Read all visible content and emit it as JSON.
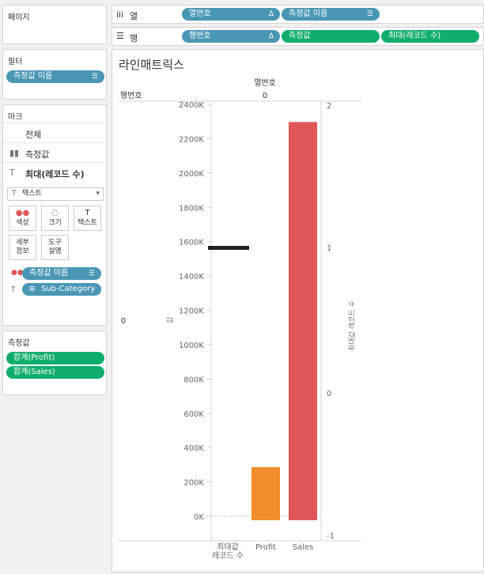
{
  "pages_label": "페이지",
  "columns_shelf": {
    "label": "열",
    "pills": [
      "열번호",
      "측정값 이름"
    ]
  },
  "rows_shelf": {
    "label": "행",
    "pills": [
      "행번호",
      "측정값",
      "최대(레코드 수)"
    ]
  },
  "filters": {
    "title": "필터",
    "pills": [
      "측정값 이름"
    ]
  },
  "marks": {
    "title": "마크",
    "all_label": "전체",
    "measure_label": "측정값",
    "max_records_label": "최대(레코드 수)",
    "mark_type": "텍스트",
    "buttons": [
      "색상",
      "크기",
      "텍스트",
      "세부 정보",
      "도구 설명"
    ],
    "button_lines": [
      [
        "색상"
      ],
      [
        "크기"
      ],
      [
        "텍스트"
      ],
      [
        "세부",
        "정보"
      ],
      [
        "도구",
        "설명"
      ]
    ],
    "pills": [
      "측정값 이름",
      "Sub-Category"
    ]
  },
  "measure_values": {
    "title": "측정값",
    "pills": [
      "합계(Profit)",
      "합계(Sales)"
    ]
  },
  "view": {
    "title": "라인매트릭스",
    "col_header": "열번호",
    "col_value": "0",
    "row_header": "행번호",
    "row_value": "0",
    "left_axis_label": "값",
    "right_axis_label": "최대값 레코드 수",
    "x_labels": [
      "최대값\n레코드 수",
      "Profit",
      "Sales"
    ]
  },
  "chart_data": {
    "type": "bar",
    "categories": [
      "최대값 레코드 수",
      "Profit",
      "Sales"
    ],
    "series": [
      {
        "name": "Profit",
        "category": "Profit",
        "value": 286397,
        "color": "#f28e2b"
      },
      {
        "name": "Sales",
        "category": "Sales",
        "value": 2297201,
        "color": "#e15759"
      }
    ],
    "left_axis": {
      "ticks": [
        "0K",
        "200K",
        "400K",
        "600K",
        "800K",
        "1000K",
        "1200K",
        "1400K",
        "1600K",
        "1800K",
        "2000K",
        "2200K",
        "2400K"
      ],
      "range": [
        -20000,
        2400000
      ]
    },
    "right_axis": {
      "ticks": [
        "2",
        "1",
        "0",
        "-1"
      ],
      "range": [
        -1,
        2
      ]
    },
    "max_records_value": 1
  }
}
